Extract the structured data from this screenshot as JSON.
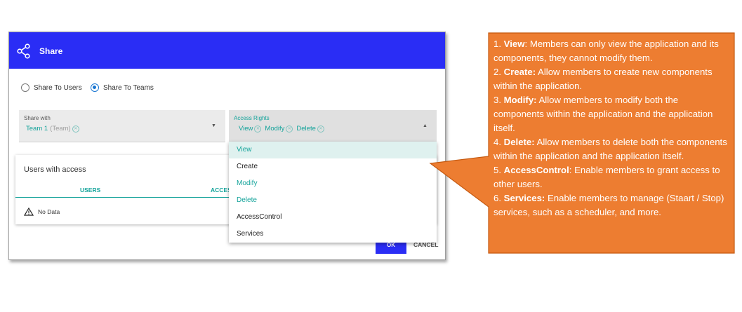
{
  "dialog": {
    "title": "Share",
    "radio": [
      {
        "label": "Share To Users",
        "selected": false
      },
      {
        "label": "Share To Teams",
        "selected": true
      }
    ],
    "share_with": {
      "label": "Share with",
      "chip_name": "Team 1",
      "chip_sub": "(Team)"
    },
    "access_rights": {
      "label": "Access Rights",
      "chips": [
        "View",
        "Modify",
        "Delete"
      ]
    },
    "users_panel": {
      "title": "Users with access",
      "tabs": [
        "USERS",
        "ACCES"
      ],
      "empty": "No Data"
    },
    "buttons": {
      "ok": "OK",
      "cancel": "CANCEL"
    }
  },
  "dropdown": {
    "options": [
      "View",
      "Create",
      "Modify",
      "Delete",
      "AccessControl",
      "Services"
    ],
    "selected": "View"
  },
  "callout": {
    "color": "#ed7d31",
    "items": [
      {
        "num": "1.",
        "term": "View",
        "sep": ":",
        "text": " Members can only view the application and its components, they cannot modify them."
      },
      {
        "num": "2.",
        "term": "Create:",
        "sep": "",
        "text": " Allow members to create new components within the application."
      },
      {
        "num": "3.",
        "term": "Modify:",
        "sep": "",
        "text": " Allow members to modify both the components within the application and the application itself."
      },
      {
        "num": "4.",
        "term": "Delete:",
        "sep": "",
        "text": " Allow members to delete both the components within the application and the application itself."
      },
      {
        "num": "5.",
        "term": "AccessControl",
        "sep": ":",
        "text": " Enable members to grant access to other users."
      },
      {
        "num": "6.",
        "term": "Services:",
        "sep": "",
        "text": " Enable members to manage (Staart / Stop) services, such as a scheduler, and more."
      }
    ]
  }
}
